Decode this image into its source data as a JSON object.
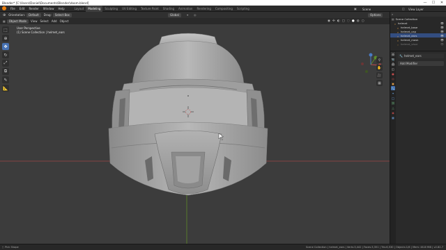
{
  "window": {
    "title": "Blender* [C:\\Users\\Daniel\\Documents\\Blender\\doom.blend]",
    "minimize_glyph": "—",
    "maximize_glyph": "☐",
    "close_glyph": "✕"
  },
  "menu": {
    "items": [
      "File",
      "Edit",
      "Render",
      "Window",
      "Help"
    ]
  },
  "workspaces": {
    "tabs": [
      "Layout",
      "Modeling",
      "Sculpting",
      "UV Editing",
      "Texture Paint",
      "Shading",
      "Animation",
      "Rendering",
      "Compositing",
      "Scripting"
    ],
    "active_index": 1
  },
  "scene": {
    "scene_label": "Scene",
    "view_layer_label": "View Layer"
  },
  "header1": {
    "orientation_label": "Orientation:",
    "orientation_value": "Default",
    "drag_label": "Drag:",
    "drag_value": "Select Box",
    "pivot_value": "Global",
    "options_label": "Options"
  },
  "header2": {
    "mode_value": "Object Mode",
    "menus": [
      "View",
      "Select",
      "Add",
      "Object"
    ]
  },
  "viewport": {
    "view_name": "User Perspective",
    "collection_info": "(1) Scene Collection | helmet_ears"
  },
  "outliner": {
    "root_label": "Scene Collection",
    "items": [
      {
        "label": "helmet",
        "dim": false
      },
      {
        "label": "helmet_base",
        "dim": false
      },
      {
        "label": "helmet_cap",
        "dim": false
      },
      {
        "label": "helmet_ears",
        "dim": false
      },
      {
        "label": "helmet_mask",
        "dim": false
      },
      {
        "label": "helmet_visor",
        "dim": true
      }
    ]
  },
  "properties": {
    "object_name": "helmet_ears",
    "add_modifier_label": "Add Modifier"
  },
  "statusbar": {
    "left_text": "Pick Shape",
    "right_text": "Scene Collection | helmet_ears | Verts:3,442 | Faces:3,351 | Tris:6,530 | Objects:1/6 | Mem: 46.8 MiB | v2.82.7"
  },
  "colors": {
    "accent": "#4772b3",
    "blender_orange": "#e87d0d",
    "viewport_bg": "#3c3c3c",
    "axis_red": "#c44c4c",
    "axis_green": "#5d8a2a"
  }
}
